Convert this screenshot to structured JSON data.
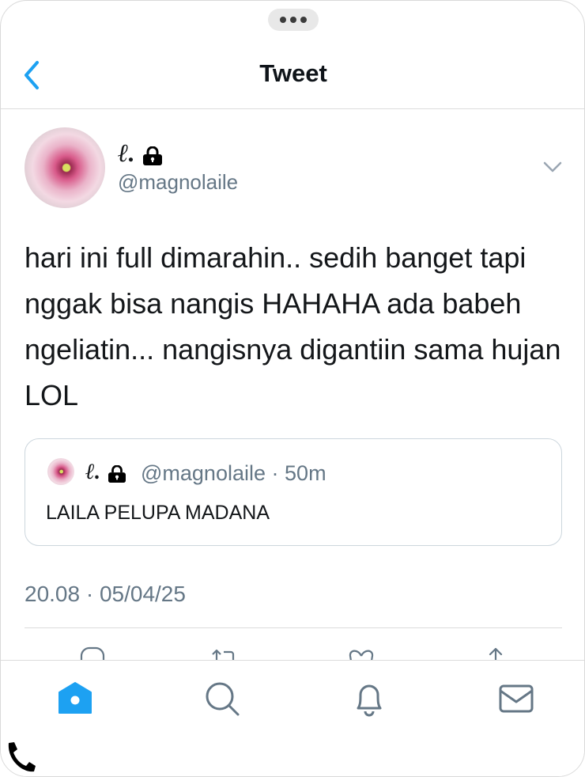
{
  "header": {
    "title": "Tweet"
  },
  "tweet": {
    "display_name": "ℓ.",
    "handle": "@magnolaile",
    "text": "hari ini full dimarahin.. sedih banget tapi nggak bisa nangis HAHAHA ada babeh ngeliatin... nangisnya digantiin sama hujan LOL",
    "timestamp": "20.08 · 05/04/25"
  },
  "quoted_tweet": {
    "display_name": "ℓ.",
    "handle": "@magnolaile",
    "age": "50m",
    "text": "LAILA PELUPA MADANA"
  },
  "icons": {
    "back": "chevron-left-icon",
    "lock": "lock-icon",
    "more": "chevron-down-icon",
    "actions": [
      "reply-icon",
      "retweet-icon",
      "like-icon",
      "share-icon"
    ],
    "tabs": [
      "home-icon",
      "search-icon",
      "notifications-icon",
      "messages-icon"
    ],
    "call": "phone-icon"
  },
  "colors": {
    "accent": "#1da1f2",
    "secondary_text": "#657786",
    "text": "#14171a",
    "border": "#ccd6dd"
  }
}
